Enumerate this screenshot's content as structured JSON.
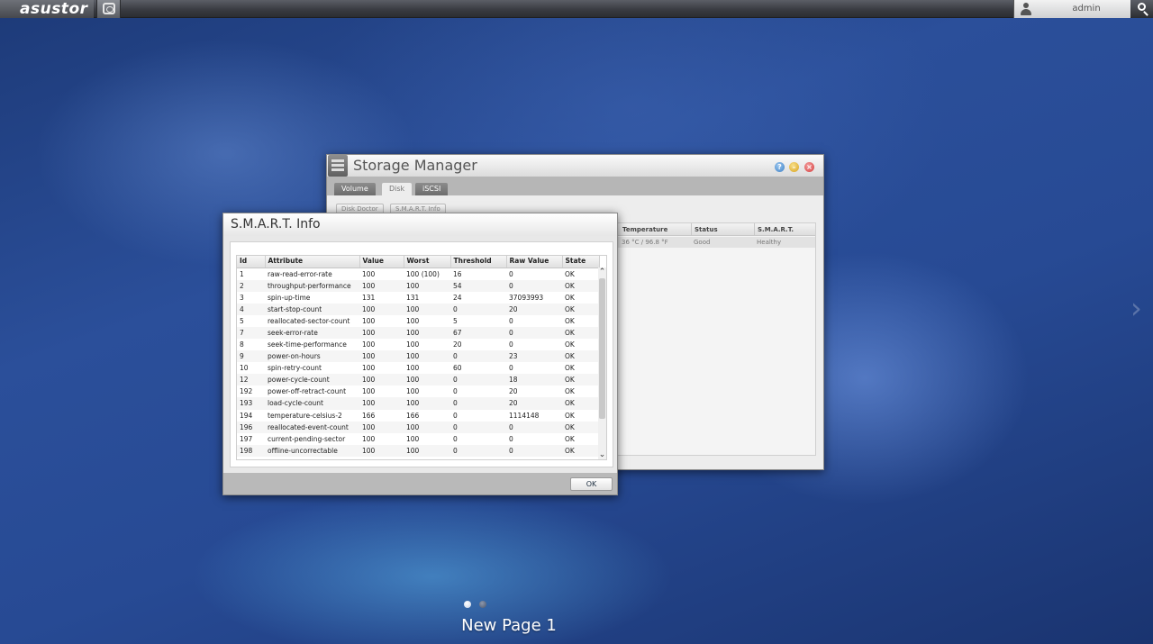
{
  "topbar": {
    "brand": "asustor",
    "username": "admin"
  },
  "storage_manager": {
    "title": "Storage Manager",
    "tabs": [
      {
        "label": "Volume"
      },
      {
        "label": "Disk",
        "active": true
      },
      {
        "label": "iSCSI"
      }
    ],
    "subtabs": [
      {
        "label": "Disk Doctor"
      },
      {
        "label": "S.M.A.R.T. Info"
      }
    ],
    "list_headers": [
      "Temperature",
      "Status",
      "S.M.A.R.T."
    ],
    "list_row": {
      "temperature": "36 °C / 96.8 °F",
      "status": "Good",
      "smart": "Healthy"
    }
  },
  "smart_dialog": {
    "title": "S.M.A.R.T. Info",
    "columns": [
      "Id",
      "Attribute",
      "Value",
      "Worst",
      "Threshold",
      "Raw Value",
      "State"
    ],
    "rows": [
      [
        "1",
        "raw-read-error-rate",
        "100",
        "100 (100)",
        "16",
        "0",
        "OK"
      ],
      [
        "2",
        "throughput-performance",
        "100",
        "100",
        "54",
        "0",
        "OK"
      ],
      [
        "3",
        "spin-up-time",
        "131",
        "131",
        "24",
        "37093993",
        "OK"
      ],
      [
        "4",
        "start-stop-count",
        "100",
        "100",
        "0",
        "20",
        "OK"
      ],
      [
        "5",
        "reallocated-sector-count",
        "100",
        "100",
        "5",
        "0",
        "OK"
      ],
      [
        "7",
        "seek-error-rate",
        "100",
        "100",
        "67",
        "0",
        "OK"
      ],
      [
        "8",
        "seek-time-performance",
        "100",
        "100",
        "20",
        "0",
        "OK"
      ],
      [
        "9",
        "power-on-hours",
        "100",
        "100",
        "0",
        "23",
        "OK"
      ],
      [
        "10",
        "spin-retry-count",
        "100",
        "100",
        "60",
        "0",
        "OK"
      ],
      [
        "12",
        "power-cycle-count",
        "100",
        "100",
        "0",
        "18",
        "OK"
      ],
      [
        "192",
        "power-off-retract-count",
        "100",
        "100",
        "0",
        "20",
        "OK"
      ],
      [
        "193",
        "load-cycle-count",
        "100",
        "100",
        "0",
        "20",
        "OK"
      ],
      [
        "194",
        "temperature-celsius-2",
        "166",
        "166",
        "0",
        "1114148",
        "OK"
      ],
      [
        "196",
        "reallocated-event-count",
        "100",
        "100",
        "0",
        "0",
        "OK"
      ],
      [
        "197",
        "current-pending-sector",
        "100",
        "100",
        "0",
        "0",
        "OK"
      ],
      [
        "198",
        "offline-uncorrectable",
        "100",
        "100",
        "0",
        "0",
        "OK"
      ]
    ],
    "ok_label": "OK"
  },
  "desktop": {
    "page_label": "New Page 1"
  },
  "icons": {
    "home": "nas-home-icon",
    "user": "user-icon",
    "search": "search-icon",
    "help": "help-icon",
    "minimize": "minimize-icon",
    "close": "close-icon",
    "scroll_up": "chevron-up-icon",
    "scroll_down": "chevron-down-icon",
    "next_page": "chevron-right-icon"
  }
}
